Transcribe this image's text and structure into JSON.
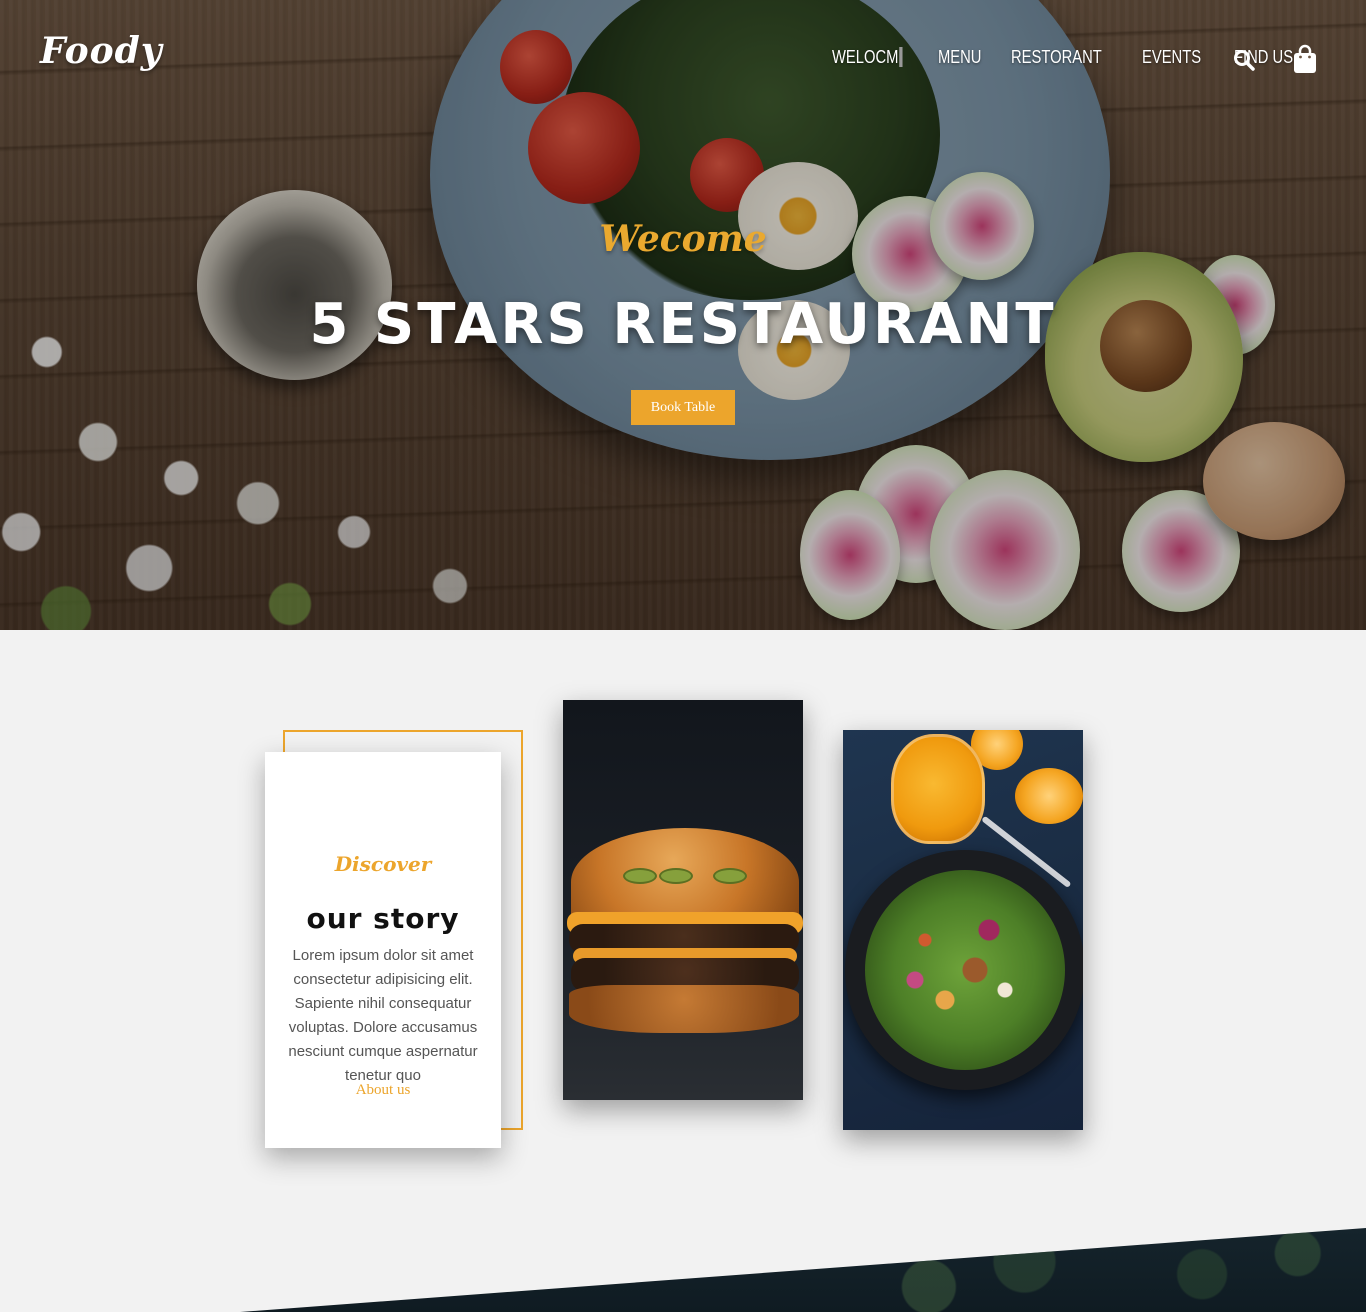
{
  "brand": {
    "logo_text": "Foody"
  },
  "nav": {
    "items": [
      {
        "label": "WELOCM"
      },
      {
        "label": "MENU"
      },
      {
        "label": "RESTORANT"
      },
      {
        "label": "EVENTS"
      },
      {
        "label": "FIND US"
      }
    ],
    "icons": [
      "search-icon",
      "shopping-bag-icon"
    ]
  },
  "hero": {
    "kicker": "Wecome",
    "title": "5 STARS RESTAURANT",
    "button_label": "Book Table"
  },
  "story": {
    "kicker": "Discover",
    "title": "our story",
    "text": "Lorem ipsum dolor sit amet consectetur adipisicing elit. Sapiente nihil consequatur voluptas. Dolore accusamus nesciunt cumque aspernatur tenetur quo",
    "link_label": "About us"
  },
  "colors": {
    "accent": "#eca52c",
    "section_background": "#f2f2f2",
    "text_dark": "#111111",
    "text_light": "#ffffff"
  }
}
